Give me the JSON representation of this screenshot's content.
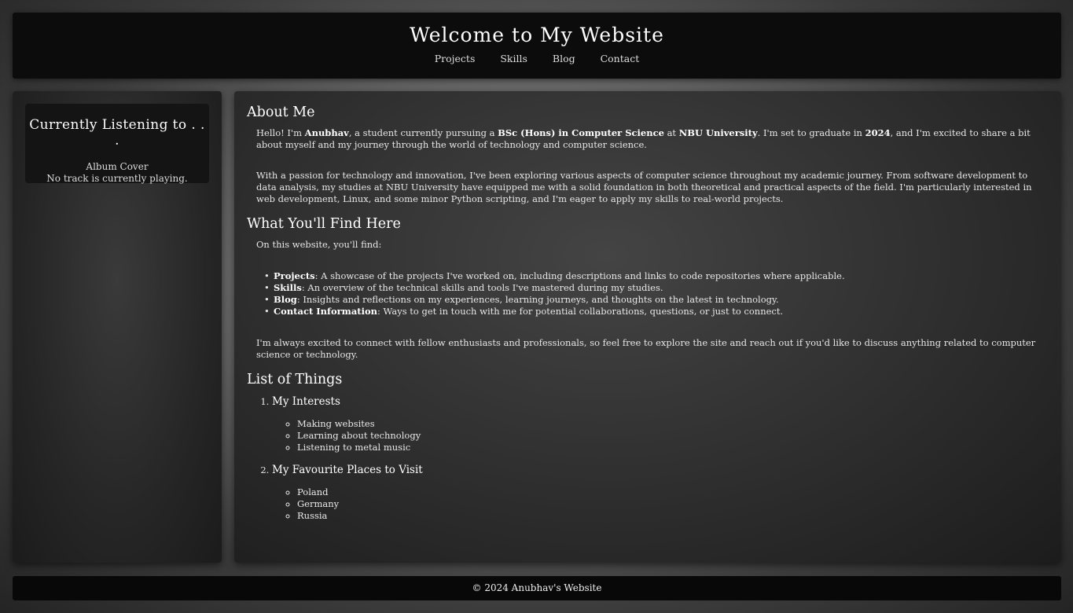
{
  "header": {
    "title": "Welcome to My Website",
    "nav": [
      "Projects",
      "Skills",
      "Blog",
      "Contact"
    ]
  },
  "sidebar": {
    "title": "Currently Listening to . . .",
    "album_cover": "Album Cover",
    "status": "No track is currently playing."
  },
  "about": {
    "heading": "About Me",
    "p1": {
      "t1": "Hello! I'm ",
      "name": "Anubhav",
      "t2": ", a student currently pursuing a ",
      "degree": "BSc (Hons) in Computer Science",
      "t3": " at ",
      "university": "NBU University",
      "t4": ". I'm set to graduate in ",
      "year": "2024",
      "t5": ", and I'm excited to share a bit about myself and my journey through the world of technology and computer science."
    },
    "p2": "With a passion for technology and innovation, I've been exploring various aspects of computer science throughout my academic journey. From software development to data analysis, my studies at NBU University have equipped me with a solid foundation in both theoretical and practical aspects of the field. I'm particularly interested in web development, Linux, and some minor Python scripting, and I'm eager to apply my skills to real-world projects."
  },
  "find": {
    "heading": "What You'll Find Here",
    "intro": "On this website, you'll find:",
    "items": [
      {
        "label": "Projects",
        "text": ": A showcase of the projects I've worked on, including descriptions and links to code repositories where applicable."
      },
      {
        "label": "Skills",
        "text": ": An overview of the technical skills and tools I've mastered during my studies."
      },
      {
        "label": "Blog",
        "text": ": Insights and reflections on my experiences, learning journeys, and thoughts on the latest in technology."
      },
      {
        "label": "Contact Information",
        "text": ": Ways to get in touch with me for potential collaborations, questions, or just to connect."
      }
    ],
    "outro": "I'm always excited to connect with fellow enthusiasts and professionals, so feel free to explore the site and reach out if you'd like to discuss anything related to computer science or technology."
  },
  "things": {
    "heading": "List of Things",
    "groups": [
      {
        "title": "My Interests",
        "items": [
          "Making websites",
          "Learning about technology",
          "Listening to metal music"
        ]
      },
      {
        "title": "My Favourite Places to Visit",
        "items": [
          "Poland",
          "Germany",
          "Russia"
        ]
      }
    ]
  },
  "footer": {
    "text": "© 2024 Anubhav's Website"
  }
}
